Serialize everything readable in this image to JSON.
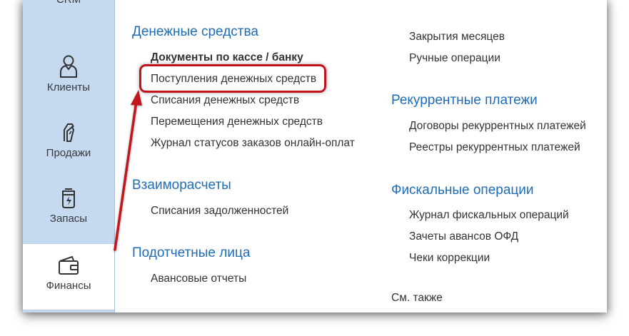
{
  "sidebar": {
    "top_cut_label": "СRM",
    "items": [
      {
        "label": "Клиенты",
        "icon": "person-icon"
      },
      {
        "label": "Продажи",
        "icon": "sales-icon"
      },
      {
        "label": "Запасы",
        "icon": "stock-icon"
      },
      {
        "label": "Финансы",
        "icon": "wallet-icon",
        "active": true
      }
    ]
  },
  "left_column": {
    "money": {
      "title": "Денежные средства",
      "links": [
        "Документы по кассе / банку",
        "Поступления денежных средств",
        "Списания денежных средств",
        "Перемещения денежных средств",
        "Журнал статусов заказов онлайн-оплат"
      ]
    },
    "settlements": {
      "title": "Взаиморасчеты",
      "links": [
        "Списания задолженностей"
      ]
    },
    "accountable": {
      "title": "Подотчетные лица",
      "links": [
        "Авансовые отчеты"
      ]
    }
  },
  "right_column": {
    "top_links": [
      "Закрытия месяцев",
      "Ручные операции"
    ],
    "recurrent": {
      "title": "Рекуррентные платежи",
      "links": [
        "Договоры рекуррентных платежей",
        "Реестры рекуррентных платежей"
      ]
    },
    "fiscal": {
      "title": "Фискальные операции",
      "links": [
        "Журнал фискальных операций",
        "Зачеты авансов ОФД",
        "Чеки коррекции"
      ]
    },
    "see_also": "См. также"
  },
  "annotation": {
    "highlight_color": "#c0121f"
  }
}
